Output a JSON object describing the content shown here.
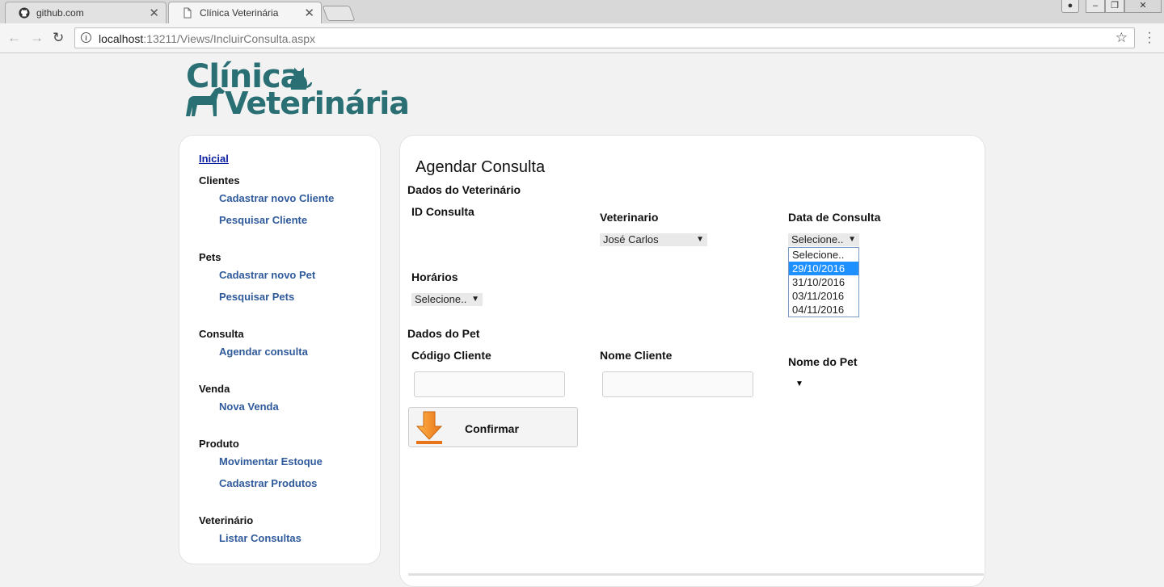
{
  "browser": {
    "tabs": [
      {
        "label": "github.com",
        "icon": "github-icon"
      },
      {
        "label": "Clínica Veterinária",
        "icon": "page-icon"
      }
    ],
    "url_host": "localhost",
    "url_rest": ":13211/Views/IncluirConsulta.aspx"
  },
  "logo": {
    "line1": "Clínica",
    "line2": "Veterinária",
    "color": "#2a6f73"
  },
  "sidebar": {
    "home": "Inicial",
    "groups": [
      {
        "title": "Clientes",
        "links": [
          "Cadastrar novo Cliente",
          "Pesquisar Cliente"
        ]
      },
      {
        "title": "Pets",
        "links": [
          "Cadastrar novo Pet",
          "Pesquisar Pets"
        ]
      },
      {
        "title": "Consulta",
        "links": [
          "Agendar consulta"
        ]
      },
      {
        "title": "Venda",
        "links": [
          "Nova Venda"
        ]
      },
      {
        "title": "Produto",
        "links": [
          "Movimentar Estoque",
          "Cadastrar Produtos"
        ]
      },
      {
        "title": "Veterinário",
        "links": [
          "Listar Consultas"
        ]
      }
    ]
  },
  "main": {
    "title": "Agendar Consulta",
    "section_vet": "Dados do Veterinário",
    "id_label": "ID Consulta",
    "vet_label": "Veterinario",
    "vet_value": "José Carlos",
    "date_label": "Data de Consulta",
    "date_value": "Selecione..",
    "date_options": [
      "Selecione..",
      "29/10/2016",
      "31/10/2016",
      "03/11/2016",
      "04/11/2016"
    ],
    "date_highlighted": "29/10/2016",
    "hours_label": "Horários",
    "hours_value": "Selecione..",
    "section_pet": "Dados do Pet",
    "client_code_label": "Código Cliente",
    "client_name_label": "Nome Cliente",
    "pet_name_label": "Nome do Pet",
    "confirm_label": "Confirmar"
  }
}
